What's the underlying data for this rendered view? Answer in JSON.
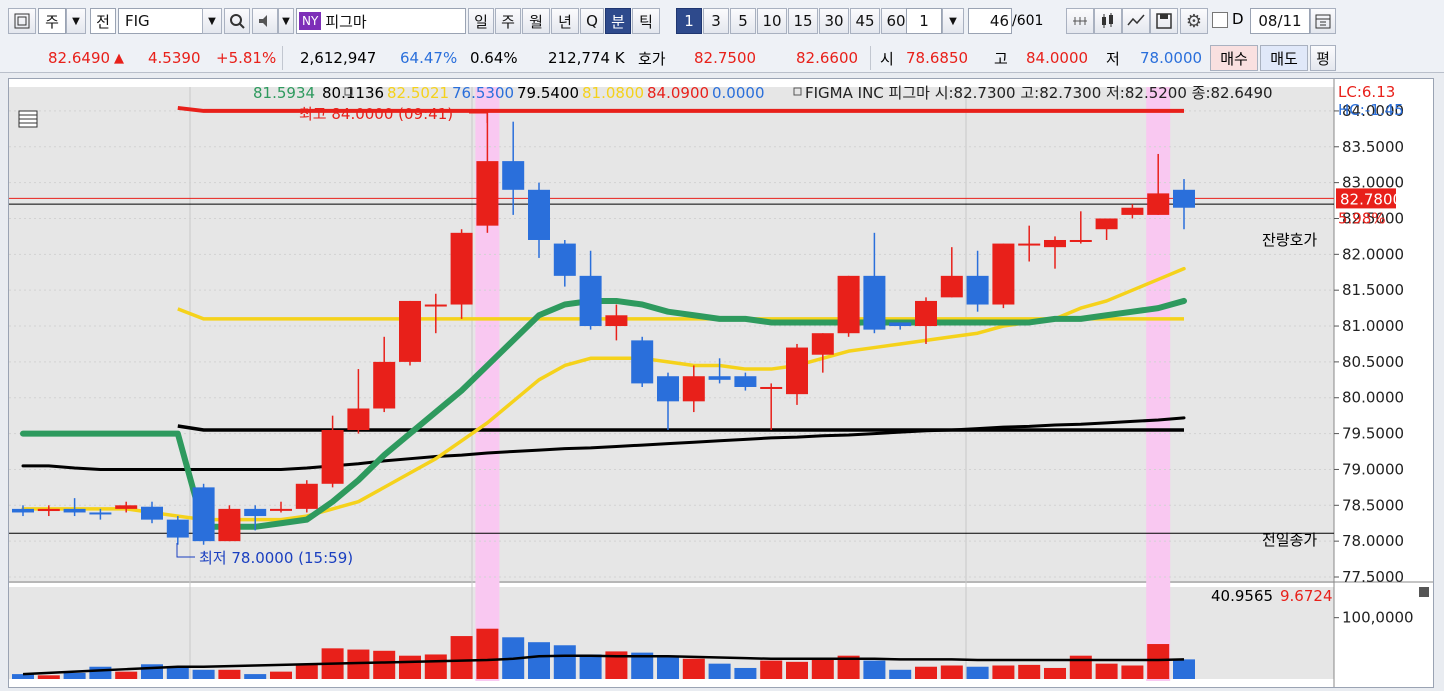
{
  "toolbar": {
    "market_label": "주",
    "all_label": "전",
    "symbol": "FIG",
    "exchange_badge": "NY",
    "stock_name": "피그마",
    "period_tabs": [
      "일",
      "주",
      "월",
      "년",
      "Q",
      "분",
      "틱"
    ],
    "period_selected": "분",
    "intervals": [
      "1",
      "3",
      "5",
      "10",
      "15",
      "30",
      "45",
      "60"
    ],
    "interval_selected": "1",
    "multiplier": "1",
    "page_current": "46",
    "page_total": "/601",
    "d_label": "D",
    "date": "08/11",
    "icons": [
      "chart-type-icon",
      "candle-tool-icon",
      "trend-tool-icon",
      "save-icon",
      "gear-icon",
      "calendar-icon"
    ]
  },
  "quote": {
    "price": "82.6490",
    "change_arrow": "▲",
    "change": "4.5390",
    "change_pct": "+5.81%",
    "volume": "2,612,947",
    "ratio1": "64.47%",
    "ratio2": "0.64%",
    "amount": "212,774 K",
    "hoga_label": "호가",
    "ask": "82.7500",
    "bid": "82.6600",
    "open_label": "시",
    "open": "78.6850",
    "high_label": "고",
    "high": "84.0000",
    "low_label": "저",
    "low": "78.0000",
    "buy_label": "매수",
    "sell_label": "매도",
    "eval_label": "평"
  },
  "colors": {
    "up": "#e8201a",
    "down": "#2a6fdb",
    "ma_green": "#2e9a5e",
    "ma_yellow": "#f5d21b",
    "ma_black": "#000000",
    "highlight": "#f9c8f1",
    "grid": "#b8bcc4"
  },
  "chart_data": {
    "type": "candlestick",
    "legend": [
      {
        "text": "81.5934",
        "color": "#2e9a5e"
      },
      {
        "text": "80.1136",
        "color": "#000000"
      },
      {
        "text": "82.5021",
        "color": "#f5d21b"
      },
      {
        "text": "76.5300",
        "color": "#2a6fdb"
      },
      {
        "text": "79.5400",
        "color": "#000000"
      },
      {
        "text": "81.0800",
        "color": "#f5d21b"
      },
      {
        "text": "84.0900",
        "color": "#e8201a"
      },
      {
        "text": "0.0000",
        "color": "#2a6fdb"
      }
    ],
    "title": "FIGMA INC  피그마 시:82.7300 고:82.7300 저:82.5200 종:82.6490",
    "lc": "LC:6.13",
    "hc": "HC:-1.45",
    "y_ticks": [
      "84.0000",
      "83.5000",
      "83.0000",
      "82.5000",
      "82.0000",
      "81.5000",
      "81.0000",
      "80.5000",
      "80.0000",
      "79.5000",
      "79.0000",
      "78.5000",
      "78.0000",
      "77.5000"
    ],
    "ylim": [
      77.5,
      84.25
    ],
    "current_price_tag": "82.7800",
    "current_price_pct": "5.98%",
    "current_price_line": 82.78,
    "anchor_line": 82.7,
    "anchor_label": "잔량호가",
    "prev_close": 78.11,
    "prev_close_label": "전일종가",
    "max_line": 84.0,
    "max_label": "최고 84.0000 (09:41)",
    "min_label": "최저 78.0000 (15:59)",
    "candles": [
      {
        "o": 78.45,
        "c": 78.4,
        "h": 78.5,
        "l": 78.35
      },
      {
        "o": 78.42,
        "c": 78.45,
        "h": 78.5,
        "l": 78.35
      },
      {
        "o": 78.45,
        "c": 78.4,
        "h": 78.6,
        "l": 78.35
      },
      {
        "o": 78.4,
        "c": 78.38,
        "h": 78.45,
        "l": 78.3
      },
      {
        "o": 78.45,
        "c": 78.5,
        "h": 78.55,
        "l": 78.4
      },
      {
        "o": 78.48,
        "c": 78.3,
        "h": 78.55,
        "l": 78.25
      },
      {
        "o": 78.3,
        "c": 78.05,
        "h": 78.35,
        "l": 77.95
      },
      {
        "o": 78.75,
        "c": 78.0,
        "h": 78.8,
        "l": 77.95
      },
      {
        "o": 78.0,
        "c": 78.45,
        "h": 78.5,
        "l": 78.0
      },
      {
        "o": 78.45,
        "c": 78.35,
        "h": 78.5,
        "l": 78.15
      },
      {
        "o": 78.45,
        "c": 78.45,
        "h": 78.55,
        "l": 78.4
      },
      {
        "o": 78.45,
        "c": 78.8,
        "h": 78.85,
        "l": 78.4
      },
      {
        "o": 78.8,
        "c": 79.55,
        "h": 79.75,
        "l": 78.75
      },
      {
        "o": 79.55,
        "c": 79.85,
        "h": 80.4,
        "l": 79.5
      },
      {
        "o": 79.85,
        "c": 80.5,
        "h": 80.85,
        "l": 79.8
      },
      {
        "o": 80.5,
        "c": 81.35,
        "h": 81.35,
        "l": 80.45
      },
      {
        "o": 81.3,
        "c": 81.3,
        "h": 81.45,
        "l": 80.9
      },
      {
        "o": 81.3,
        "c": 82.3,
        "h": 82.35,
        "l": 81.1
      },
      {
        "o": 82.4,
        "c": 83.3,
        "h": 84.0,
        "l": 82.3
      },
      {
        "o": 83.3,
        "c": 82.9,
        "h": 83.85,
        "l": 82.55
      },
      {
        "o": 82.9,
        "c": 82.2,
        "h": 83.0,
        "l": 81.95
      },
      {
        "o": 82.15,
        "c": 81.7,
        "h": 82.2,
        "l": 81.55
      },
      {
        "o": 81.7,
        "c": 81.0,
        "h": 82.05,
        "l": 80.95
      },
      {
        "o": 81.0,
        "c": 81.15,
        "h": 81.3,
        "l": 80.8
      },
      {
        "o": 80.8,
        "c": 80.2,
        "h": 80.85,
        "l": 80.15
      },
      {
        "o": 80.3,
        "c": 79.95,
        "h": 80.35,
        "l": 79.55
      },
      {
        "o": 79.95,
        "c": 80.3,
        "h": 80.45,
        "l": 79.8
      },
      {
        "o": 80.3,
        "c": 80.25,
        "h": 80.55,
        "l": 80.2
      },
      {
        "o": 80.3,
        "c": 80.15,
        "h": 80.35,
        "l": 80.1
      },
      {
        "o": 80.15,
        "c": 80.15,
        "h": 80.2,
        "l": 79.55
      },
      {
        "o": 80.05,
        "c": 80.7,
        "h": 80.75,
        "l": 79.9
      },
      {
        "o": 80.6,
        "c": 80.9,
        "h": 80.9,
        "l": 80.35
      },
      {
        "o": 80.9,
        "c": 81.7,
        "h": 81.7,
        "l": 80.85
      },
      {
        "o": 81.7,
        "c": 80.95,
        "h": 82.3,
        "l": 80.9
      },
      {
        "o": 81.05,
        "c": 81.0,
        "h": 81.05,
        "l": 80.95
      },
      {
        "o": 81.0,
        "c": 81.35,
        "h": 81.4,
        "l": 80.75
      },
      {
        "o": 81.4,
        "c": 81.7,
        "h": 82.1,
        "l": 81.4
      },
      {
        "o": 81.7,
        "c": 81.3,
        "h": 82.05,
        "l": 81.2
      },
      {
        "o": 81.3,
        "c": 82.15,
        "h": 82.15,
        "l": 81.25
      },
      {
        "o": 82.15,
        "c": 82.15,
        "h": 82.4,
        "l": 81.9
      },
      {
        "o": 82.1,
        "c": 82.2,
        "h": 82.25,
        "l": 81.8
      },
      {
        "o": 82.2,
        "c": 82.2,
        "h": 82.6,
        "l": 82.15
      },
      {
        "o": 82.35,
        "c": 82.5,
        "h": 82.5,
        "l": 82.2
      },
      {
        "o": 82.55,
        "c": 82.65,
        "h": 82.7,
        "l": 82.5
      },
      {
        "o": 82.55,
        "c": 82.85,
        "h": 83.4,
        "l": 82.55
      },
      {
        "o": 82.9,
        "c": 82.65,
        "h": 83.05,
        "l": 82.35
      }
    ],
    "ma_green": [
      79.5,
      79.5,
      79.5,
      79.5,
      79.5,
      79.5,
      79.5,
      78.2,
      78.2,
      78.2,
      78.25,
      78.3,
      78.55,
      78.85,
      79.2,
      79.5,
      79.8,
      80.1,
      80.45,
      80.8,
      81.15,
      81.3,
      81.35,
      81.35,
      81.3,
      81.2,
      81.15,
      81.1,
      81.1,
      81.05,
      81.05,
      81.05,
      81.05,
      81.05,
      81.05,
      81.05,
      81.05,
      81.05,
      81.05,
      81.05,
      81.1,
      81.1,
      81.15,
      81.2,
      81.25,
      81.35
    ],
    "ma_yellow": [
      78.45,
      78.45,
      78.45,
      78.45,
      78.45,
      78.4,
      78.35,
      78.3,
      78.3,
      78.3,
      78.3,
      78.35,
      78.45,
      78.55,
      78.75,
      78.95,
      79.15,
      79.4,
      79.65,
      79.95,
      80.25,
      80.45,
      80.55,
      80.55,
      80.55,
      80.5,
      80.45,
      80.45,
      80.4,
      80.4,
      80.45,
      80.55,
      80.65,
      80.7,
      80.75,
      80.8,
      80.85,
      80.9,
      81.0,
      81.05,
      81.1,
      81.25,
      81.35,
      81.5,
      81.65,
      81.8
    ],
    "ma_black": [
      79.05,
      79.05,
      79.02,
      79.0,
      79.0,
      79.0,
      79.0,
      79.0,
      79.0,
      79.0,
      79.0,
      79.02,
      79.05,
      79.08,
      79.12,
      79.15,
      79.18,
      79.2,
      79.23,
      79.25,
      79.27,
      79.29,
      79.3,
      79.32,
      79.34,
      79.36,
      79.38,
      79.4,
      79.42,
      79.44,
      79.45,
      79.47,
      79.48,
      79.5,
      79.52,
      79.54,
      79.55,
      79.57,
      79.59,
      79.6,
      79.62,
      79.63,
      79.65,
      79.67,
      79.69,
      79.72
    ],
    "line_yellow_flat": 81.1,
    "line_black_flat": 79.55,
    "volume": {
      "legend": [
        {
          "text": "40.9565",
          "color": "#000000"
        },
        {
          "text": "9.6724",
          "color": "#e8201a"
        }
      ],
      "tick": "100,0000",
      "ymax": 150,
      "values": [
        8,
        6,
        10,
        20,
        12,
        24,
        18,
        15,
        15,
        8,
        12,
        25,
        50,
        48,
        46,
        38,
        40,
        70,
        82,
        68,
        60,
        55,
        40,
        45,
        43,
        35,
        33,
        25,
        18,
        30,
        28,
        33,
        38,
        30,
        15,
        20,
        22,
        20,
        22,
        23,
        18,
        38,
        25,
        22,
        57,
        32
      ],
      "ma": [
        8,
        10,
        12,
        14,
        16,
        18,
        20,
        20,
        21,
        22,
        23,
        24,
        25,
        26,
        27,
        28,
        29,
        30,
        31,
        33,
        37,
        38,
        38,
        37,
        37,
        37,
        36,
        35,
        34,
        33,
        33,
        33,
        33,
        33,
        32,
        32,
        32,
        31,
        31,
        31,
        31,
        31,
        31,
        31,
        31,
        32
      ]
    }
  }
}
